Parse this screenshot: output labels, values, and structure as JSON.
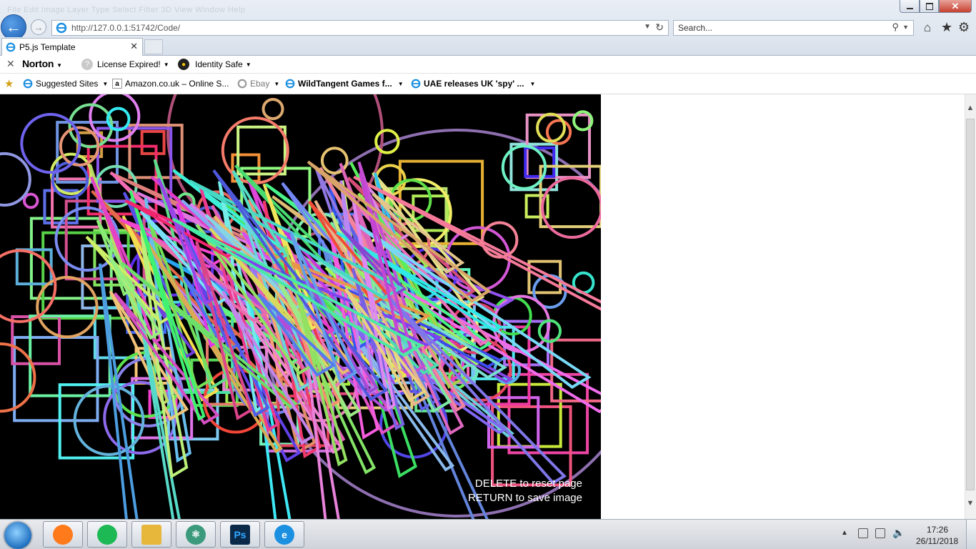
{
  "window": {
    "menu_ghost": "File  Edit  Image  Layer  Type  Select  Filter  3D  View  Window  Help"
  },
  "address_bar": {
    "url": "http://127.0.0.1:51742/Code/"
  },
  "search": {
    "placeholder": "Search..."
  },
  "tab": {
    "title": "P5.js Template"
  },
  "norton_bar": {
    "logo": "Norton",
    "license": "License Expired!",
    "identity": "Identity Safe"
  },
  "favorites": [
    {
      "label": "Suggested Sites",
      "bold": false
    },
    {
      "label": "Amazon.co.uk – Online S...",
      "bold": false
    },
    {
      "label": "Ebay",
      "bold": false
    },
    {
      "label": "WildTangent Games f...",
      "bold": true
    },
    {
      "label": "UAE releases UK 'spy' ...",
      "bold": true
    }
  ],
  "sketch": {
    "hint_reset": "DELETE to reset page",
    "hint_save": "RETURN to save image"
  },
  "taskbar": {
    "apps": [
      {
        "name": "firefox-icon",
        "glyph": "",
        "color": "#ff7a1a"
      },
      {
        "name": "spotify-icon",
        "glyph": "",
        "color": "#1db954"
      },
      {
        "name": "file-explorer-icon",
        "glyph": "",
        "color": "#e6b73a"
      },
      {
        "name": "atom-icon",
        "glyph": "⚛",
        "color": "#3c9a7c"
      },
      {
        "name": "photoshop-icon",
        "glyph": "Ps",
        "color": "#0b2a4a"
      },
      {
        "name": "internet-explorer-icon",
        "glyph": "e",
        "color": "#1b8fe0"
      }
    ],
    "time": "17:26",
    "date": "26/11/2018"
  },
  "colors": {
    "accent": "#1d5fb5",
    "canvas_bg": "#000000"
  }
}
